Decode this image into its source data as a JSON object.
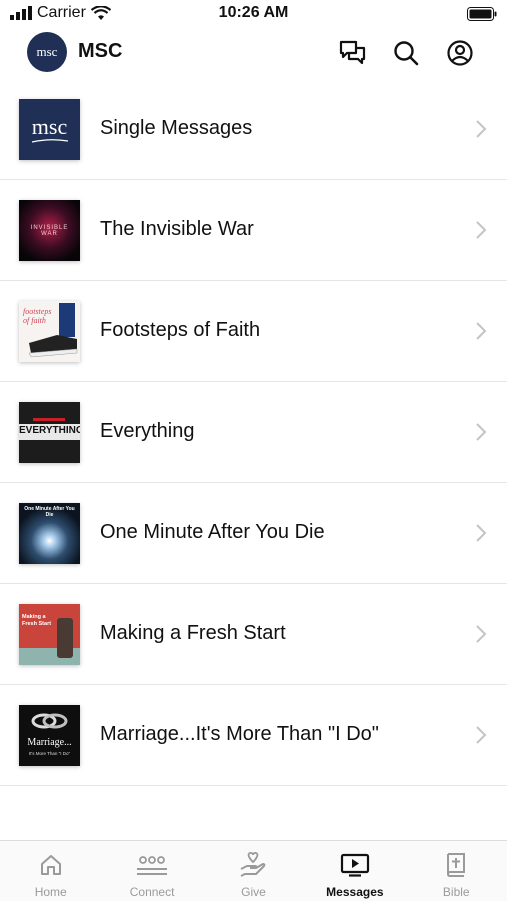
{
  "status_bar": {
    "carrier": "Carrier",
    "time": "10:26 AM"
  },
  "header": {
    "logo_text": "msc",
    "title": "MSC",
    "icons": [
      "chat-icon",
      "search-icon",
      "profile-icon"
    ]
  },
  "series": [
    {
      "label": "Single Messages",
      "thumb_text": "msc"
    },
    {
      "label": "The Invisible War",
      "thumb_text": "INVISIBLE WAR"
    },
    {
      "label": "Footsteps of Faith",
      "thumb_text": "footsteps of faith"
    },
    {
      "label": "Everything",
      "thumb_text": "EVERYTHING"
    },
    {
      "label": "One Minute After You Die",
      "thumb_text": "One Minute After You Die"
    },
    {
      "label": "Making a Fresh Start",
      "thumb_text": "Making a Fresh Start"
    },
    {
      "label": "Marriage...It's More Than \"I Do\"",
      "thumb_text": "Marriage...",
      "thumb_subtext": "It's More Than \"I Do\""
    }
  ],
  "tabs": [
    {
      "label": "Home",
      "icon": "home-icon",
      "active": false
    },
    {
      "label": "Connect",
      "icon": "connect-icon",
      "active": false
    },
    {
      "label": "Give",
      "icon": "give-icon",
      "active": false
    },
    {
      "label": "Messages",
      "icon": "messages-icon",
      "active": true
    },
    {
      "label": "Bible",
      "icon": "bible-icon",
      "active": false
    }
  ],
  "colors": {
    "brand_navy": "#1f2f55",
    "active_tab": "#111111",
    "inactive_tab": "#9a9a9a"
  }
}
